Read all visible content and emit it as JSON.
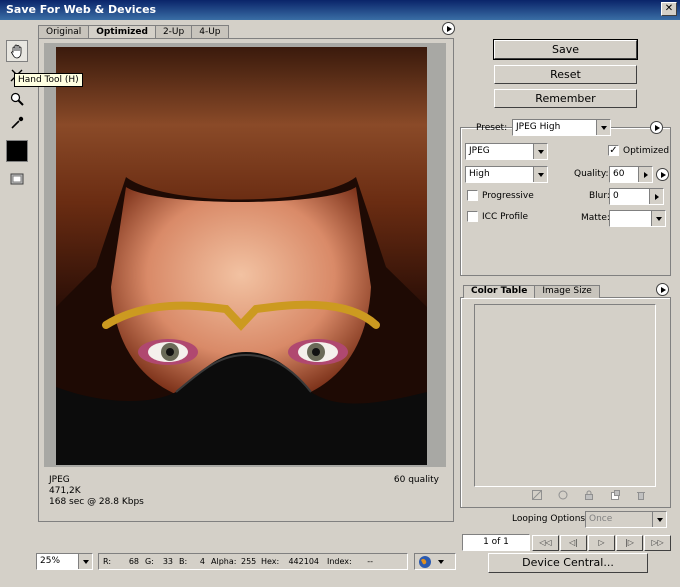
{
  "window": {
    "title": "Save For Web & Devices",
    "close": "✕"
  },
  "tooltip": "Hand Tool (H)",
  "tabs": [
    "Original",
    "Optimized",
    "2-Up",
    "4-Up"
  ],
  "image_info": {
    "format": "JPEG",
    "size": "471,2K",
    "time": "168 sec @ 28.8 Kbps",
    "quality": "60 quality"
  },
  "buttons": {
    "save": "Save",
    "reset": "Reset",
    "remember": "Remember",
    "device_central": "Device Central..."
  },
  "settings": {
    "preset_label": "Preset:",
    "preset_value": "JPEG High",
    "format": "JPEG",
    "optimized_label": "Optimized",
    "optimized_checked": true,
    "compression": "High",
    "quality_label": "Quality:",
    "quality_value": "60",
    "progressive_label": "Progressive",
    "blur_label": "Blur:",
    "blur_value": "0",
    "icc_label": "ICC Profile",
    "matte_label": "Matte:",
    "matte_value": ""
  },
  "color_panel": {
    "tab_color_table": "Color Table",
    "tab_image_size": "Image Size"
  },
  "animation": {
    "looping_label": "Looping Options:",
    "looping_value": "Once",
    "frame": "1 of 1",
    "nav": [
      "◁◁",
      "◁|",
      "▷",
      "|▷",
      "▷▷"
    ]
  },
  "status": {
    "zoom": "25%",
    "r_label": "R:",
    "r": "68",
    "g_label": "G:",
    "g": "33",
    "b_label": "B:",
    "b": "4",
    "alpha_label": "Alpha:",
    "alpha": "255",
    "hex_label": "Hex:",
    "hex": "442104",
    "index_label": "Index:",
    "index": "--"
  }
}
